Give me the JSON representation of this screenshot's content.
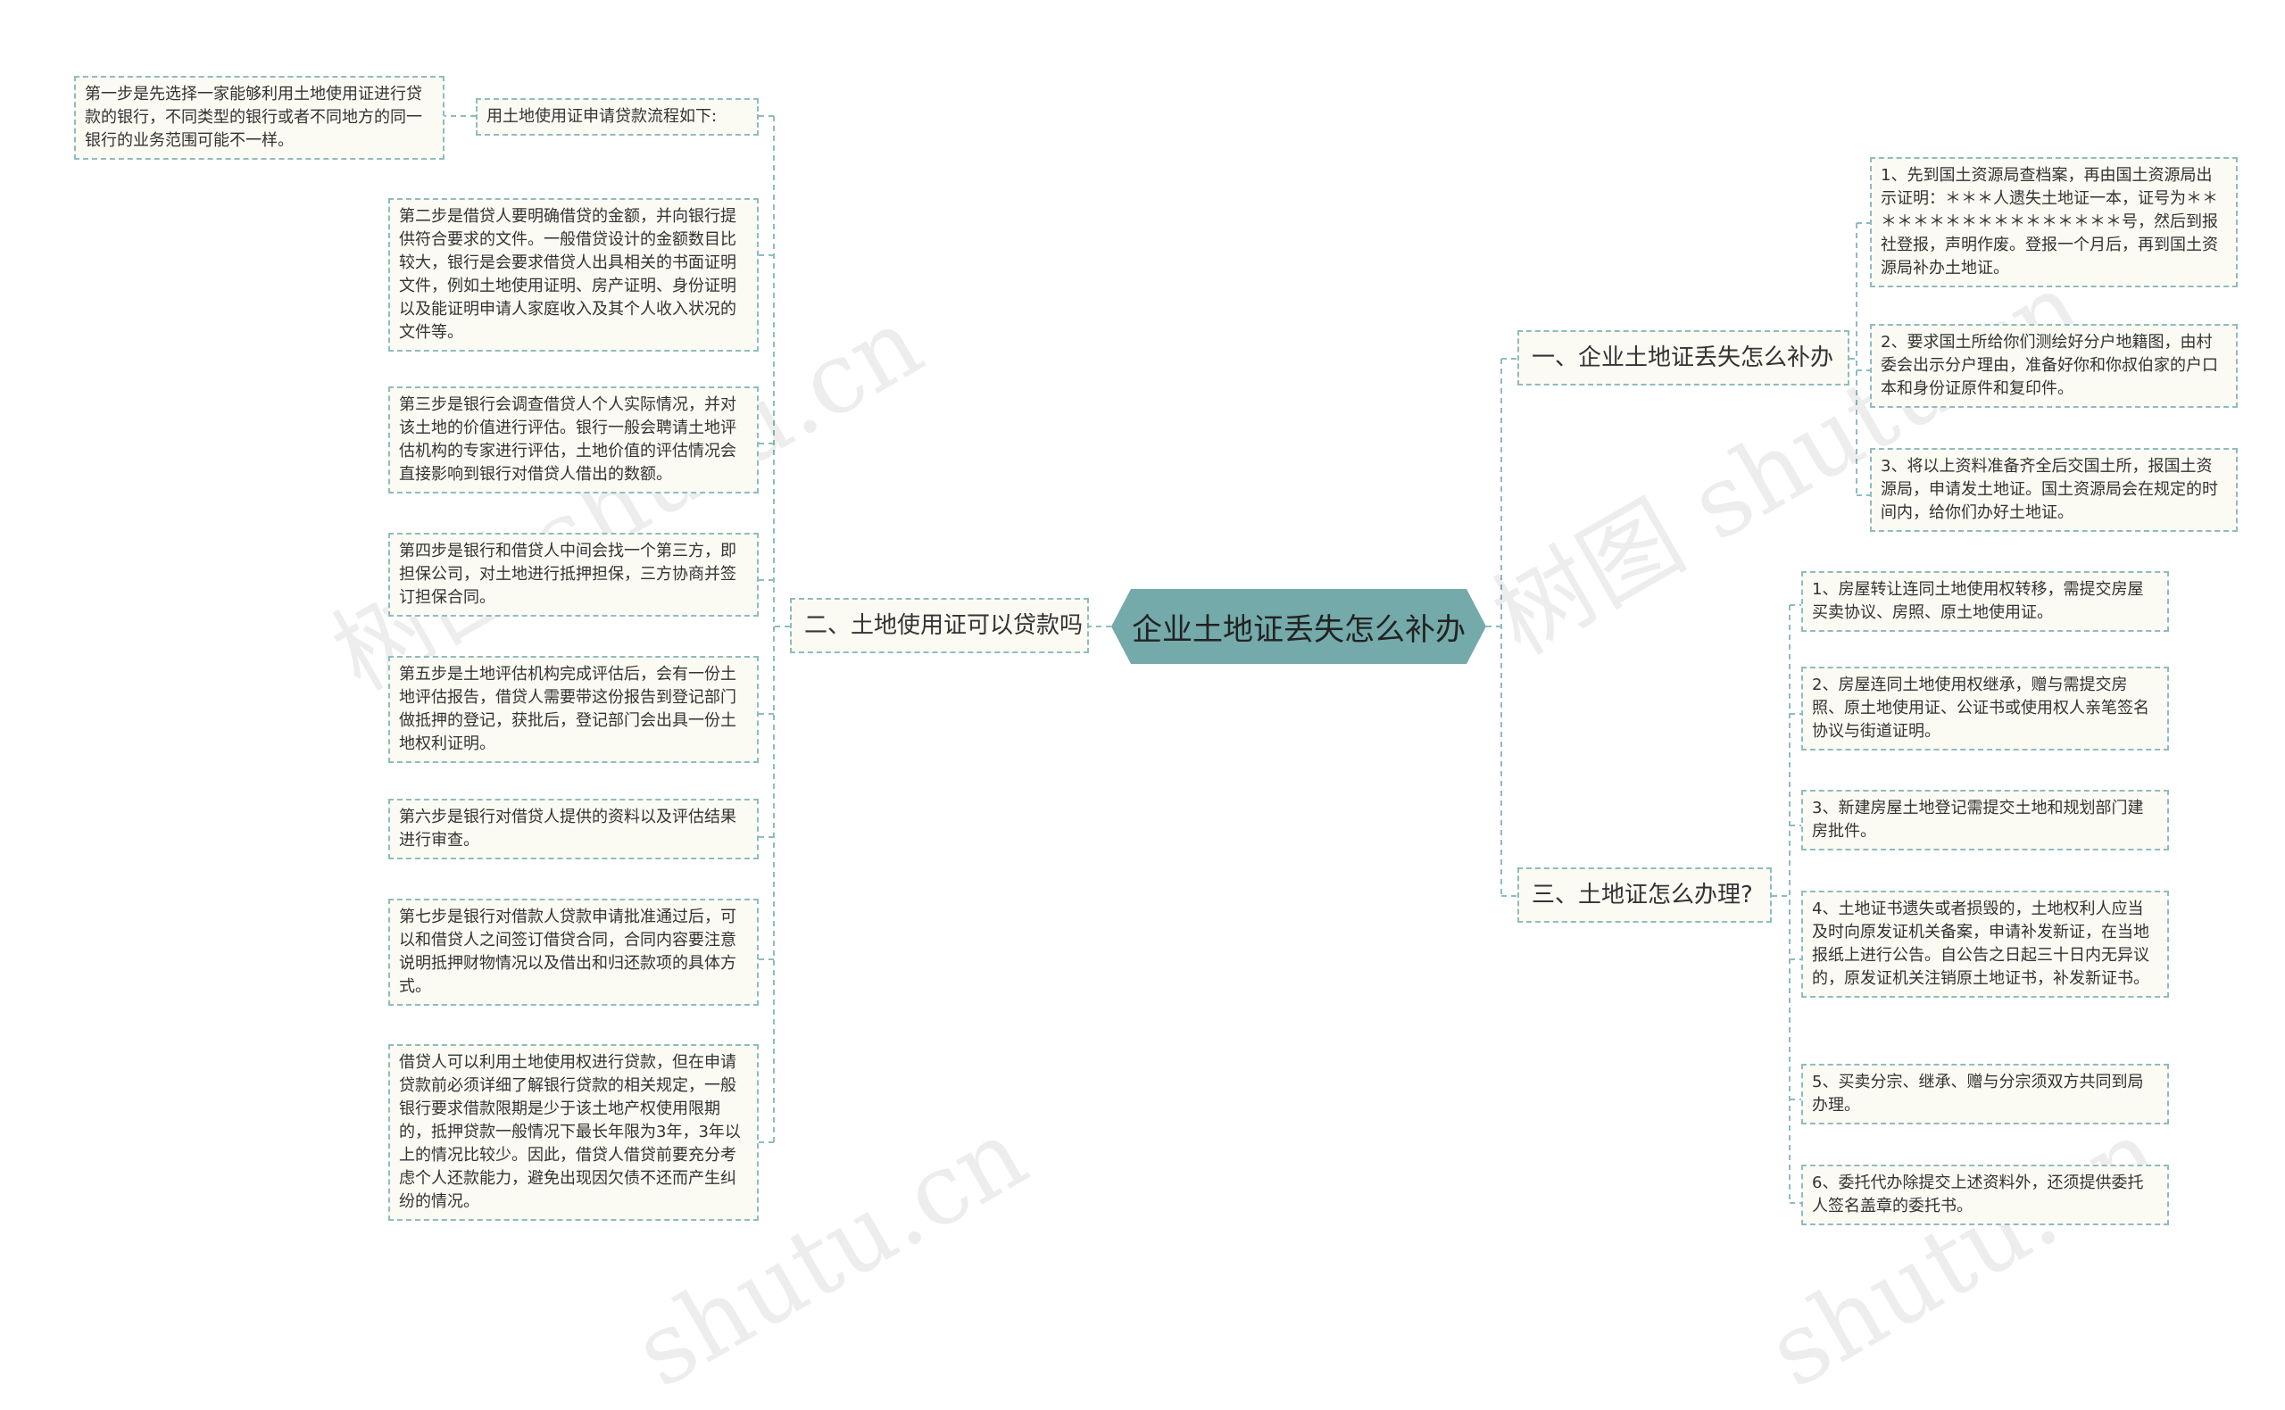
{
  "root": "企业土地证丢失怎么补办",
  "branches": {
    "b1": "一、企业土地证丢失怎么补办",
    "b2": "二、土地使用证可以贷款吗",
    "b3": "三、土地证怎么办理?"
  },
  "left": {
    "intro": "用土地使用证申请贷款流程如下:",
    "step1": "第一步是先选择一家能够利用土地使用证进行贷款的银行，不同类型的银行或者不同地方的同一银行的业务范围可能不一样。",
    "step2": "第二步是借贷人要明确借贷的金额，并向银行提供符合要求的文件。一般借贷设计的金额数目比较大，银行是会要求借贷人出具相关的书面证明文件，例如土地使用证明、房产证明、身份证明以及能证明申请人家庭收入及其个人收入状况的文件等。",
    "step3": "第三步是银行会调查借贷人个人实际情况，并对该土地的价值进行评估。银行一般会聘请土地评估机构的专家进行评估，土地价值的评估情况会直接影响到银行对借贷人借出的数额。",
    "step4": "第四步是银行和借贷人中间会找一个第三方，即担保公司，对土地进行抵押担保，三方协商并签订担保合同。",
    "step5": "第五步是土地评估机构完成评估后，会有一份土地评估报告，借贷人需要带这份报告到登记部门做抵押的登记，获批后，登记部门会出具一份土地权利证明。",
    "step6": "第六步是银行对借贷人提供的资料以及评估结果进行审查。",
    "step7": "第七步是银行对借款人贷款申请批准通过后，可以和借贷人之间签订借贷合同，合同内容要注意说明抵押财物情况以及借出和归还款项的具体方式。",
    "note": "借贷人可以利用土地使用权进行贷款，但在申请贷款前必须详细了解银行贷款的相关规定，一般银行要求借款限期是少于该土地产权使用限期的，抵押贷款一般情况下最长年限为3年，3年以上的情况比较少。因此，借贷人借贷前要充分考虑个人还款能力，避免出现因欠债不还而产生纠纷的情况。"
  },
  "right1": {
    "r1": "1、先到国土资源局查档案，再由国土资源局出示证明：＊＊＊人遗失土地证一本，证号为＊＊＊＊＊＊＊＊＊＊＊＊＊＊＊＊＊号，然后到报社登报，声明作废。登报一个月后，再到国土资源局补办土地证。",
    "r2": "2、要求国土所给你们测绘好分户地籍图，由村委会出示分户理由，准备好你和你叔伯家的户口本和身份证原件和复印件。",
    "r3": "3、将以上资料准备齐全后交国土所，报国土资源局，申请发土地证。国土资源局会在规定的时间内，给你们办好土地证。"
  },
  "right3": {
    "s1": "1、房屋转让连同土地使用权转移，需提交房屋买卖协议、房照、原土地使用证。",
    "s2": "2、房屋连同土地使用权继承，赠与需提交房照、原土地使用证、公证书或使用权人亲笔签名协议与街道证明。",
    "s3": "3、新建房屋土地登记需提交土地和规划部门建房批件。",
    "s4": "4、土地证书遗失或者损毁的，土地权利人应当及时向原发证机关备案，申请补发新证，在当地报纸上进行公告。自公告之日起三十日内无异议的，原发证机关注销原土地证书，补发新证书。",
    "s5": "5、买卖分宗、继承、赠与分宗须双方共同到局办理。",
    "s6": "6、委托代办除提交上述资料外，还须提供委托人签名盖章的委托书。"
  },
  "watermark": [
    "树图 shutu.cn",
    "树图 shutu.cn",
    "shutu.cn",
    "shutu.cn"
  ],
  "colors": {
    "root": "#74aaa9",
    "border": "#8fbcbe",
    "node_bg": "#fbfaf3",
    "line": "#8fbcbe"
  }
}
